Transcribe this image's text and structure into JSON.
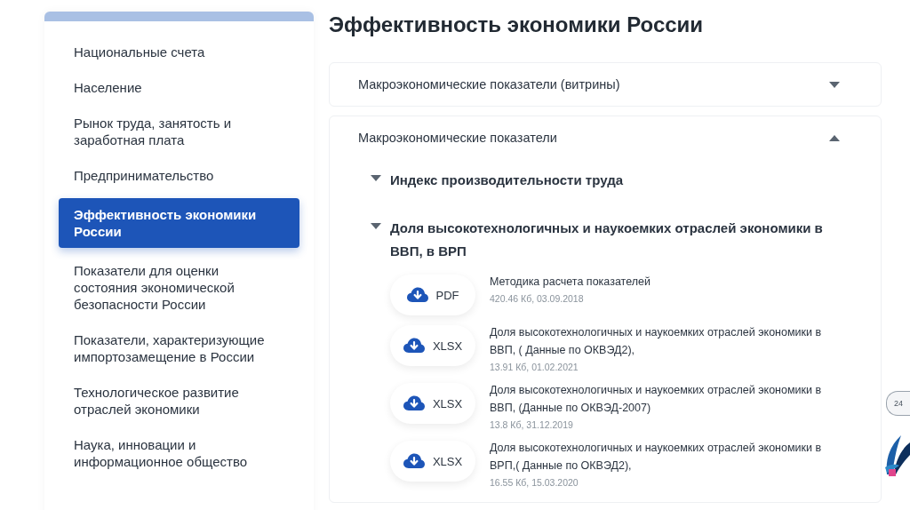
{
  "sidebar": {
    "items": [
      {
        "label": "Национальные счета",
        "selected": false
      },
      {
        "label": "Население",
        "selected": false
      },
      {
        "label": "Рынок труда, занятость и заработная плата",
        "selected": false
      },
      {
        "label": "Предпринимательство",
        "selected": false
      },
      {
        "label": "Эффективность экономики России",
        "selected": true
      },
      {
        "label": "Показатели для оценки состояния экономической безопасности России",
        "selected": false
      },
      {
        "label": "Показатели, характеризующие импортозамещение в России",
        "selected": false
      },
      {
        "label": "Технологическое развитие отраслей экономики",
        "selected": false
      },
      {
        "label": "Наука, инновации и информационное общество",
        "selected": false
      }
    ]
  },
  "title": "Эффективность экономики России",
  "accordion": [
    {
      "title": "Макроэкономические показатели (витрины)",
      "expanded": false
    },
    {
      "title": "Макроэкономические показатели",
      "expanded": true,
      "children": [
        {
          "title": "Индекс производительности труда",
          "expanded": false
        },
        {
          "title": "Доля высокотехнологичных и наукоемких отраслей экономики в ВВП, в ВРП",
          "expanded": true,
          "files": [
            {
              "format": "PDF",
              "name": "Методика расчета показателей",
              "meta": "420.46 Кб, 03.09.2018"
            },
            {
              "format": "XLSX",
              "name": "Доля высокотехнологичных и наукоемких отраслей экономики в ВВП, ( Данные по ОКВЭД2),",
              "meta": "13.91 Кб, 01.02.2021"
            },
            {
              "format": "XLSX",
              "name": "Доля высокотехнологичных и наукоемких отраслей экономики в ВВП, (Данные по ОКВЭД-2007)",
              "meta": "13.8 Кб, 31.12.2019"
            },
            {
              "format": "XLSX",
              "name": "Доля высокотехнологичных и наукоемких отраслей экономики в ВРП,( Данные по ОКВЭД2),",
              "meta": "16.55 Кб, 15.03.2020"
            }
          ]
        }
      ]
    }
  ],
  "support_badge": {
    "label": "24"
  }
}
